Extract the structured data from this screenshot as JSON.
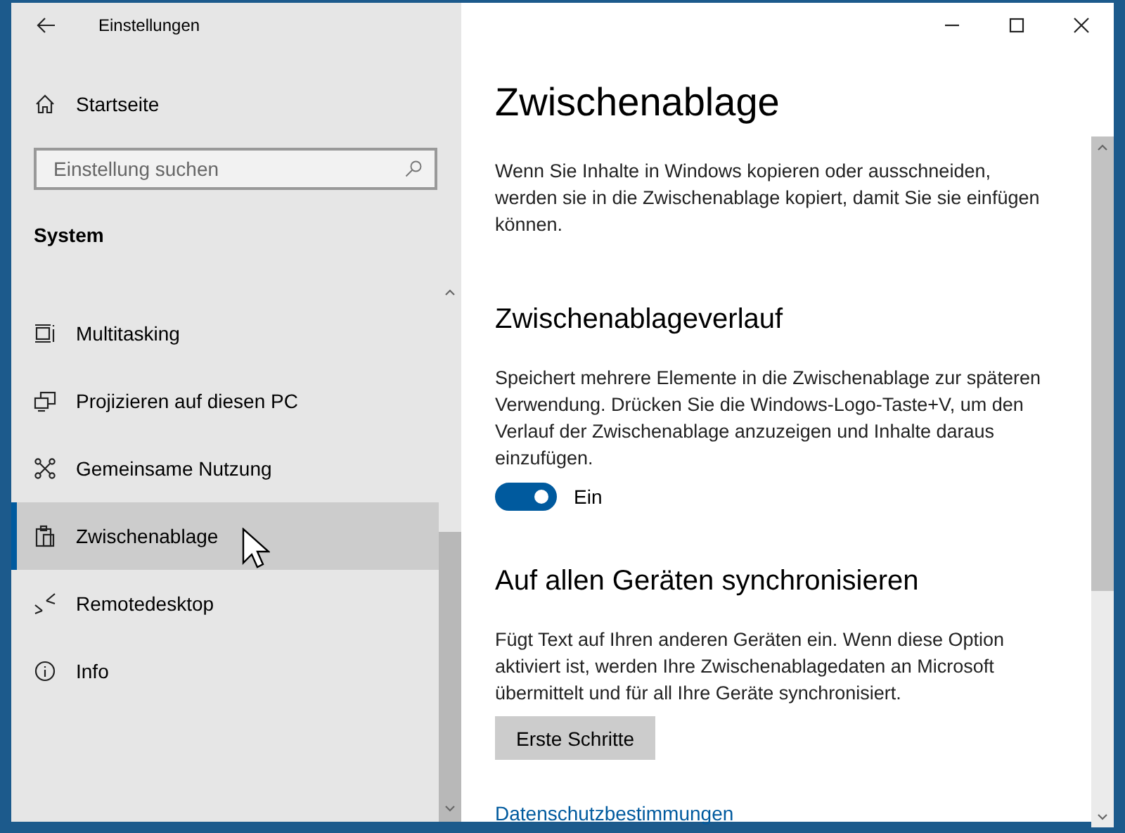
{
  "window": {
    "title": "Einstellungen"
  },
  "sidebar": {
    "home": "Startseite",
    "search": {
      "placeholder": "Einstellung suchen"
    },
    "section": "System",
    "items": [
      {
        "label": "Multitasking",
        "selected": false
      },
      {
        "label": "Projizieren auf diesen PC",
        "selected": false
      },
      {
        "label": "Gemeinsame Nutzung",
        "selected": false
      },
      {
        "label": "Zwischenablage",
        "selected": true
      },
      {
        "label": "Remotedesktop",
        "selected": false
      },
      {
        "label": "Info",
        "selected": false
      }
    ]
  },
  "page": {
    "title": "Zwischenablage",
    "intro": "Wenn Sie Inhalte in Windows kopieren oder ausschneiden, werden sie in die Zwischenablage kopiert, damit Sie sie einfügen können.",
    "sections": [
      {
        "kind": "toggle",
        "heading": "Zwischenablageverlauf",
        "text": "Speichert mehrere Elemente in die Zwischenablage zur späteren Verwendung. Drücken Sie die Windows-Logo-Taste+V, um den Verlauf der Zwischenablage anzuzeigen und Inhalte daraus einzufügen.",
        "on": true,
        "state_label": "Ein"
      },
      {
        "kind": "button",
        "heading": "Auf allen Geräten synchronisieren",
        "text": "Fügt Text auf Ihren anderen Geräten ein. Wenn diese Option aktiviert ist, werden Ihre Zwischenablagedaten an Microsoft übermittelt und für all Ihre Geräte synchronisiert.",
        "button": "Erste Schritte"
      }
    ],
    "link": "Datenschutzbestimmungen"
  }
}
